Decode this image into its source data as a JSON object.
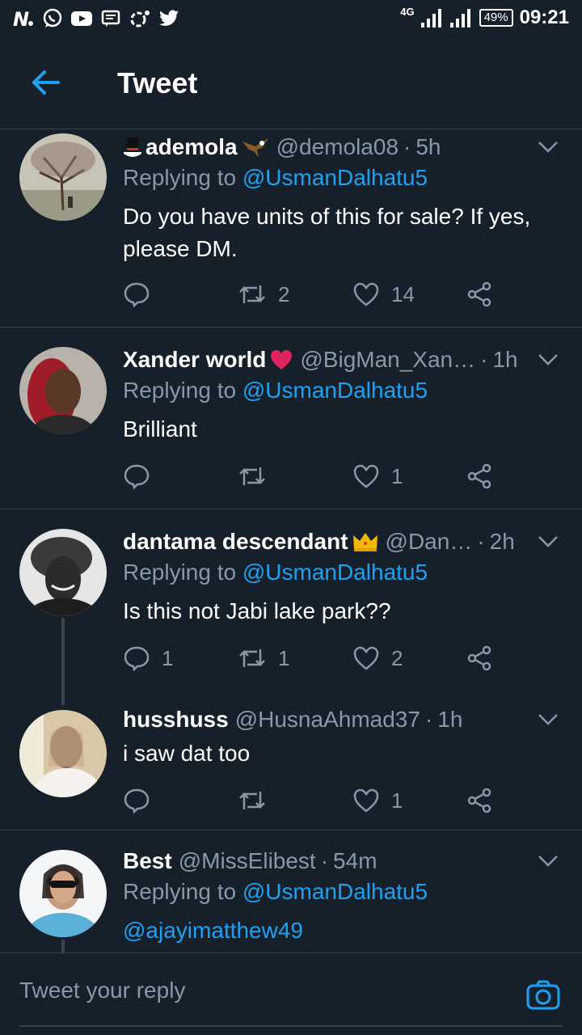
{
  "status_bar": {
    "network": "4G",
    "battery": "49%",
    "time": "09:21",
    "left_icons": [
      "news-icon",
      "whatsapp-icon",
      "youtube-icon",
      "message-icon",
      "ring-icon",
      "twitter-icon"
    ]
  },
  "header": {
    "title": "Tweet",
    "back_icon": "back-arrow-icon"
  },
  "tweets": [
    {
      "display_name": "ademola",
      "handle": "@demola08",
      "time": "5h",
      "reply_prefix": "Replying to ",
      "reply_to": "@UsmanDalhatu5",
      "text": "Do you have units of this for sale? If yes, please DM.",
      "replies": "",
      "retweets": "2",
      "likes": "14"
    },
    {
      "display_name": "Xander world",
      "handle": "@BigMan_Xan…",
      "time": "1h",
      "reply_prefix": "Replying to ",
      "reply_to": "@UsmanDalhatu5",
      "text": "Brilliant",
      "replies": "",
      "retweets": "",
      "likes": "1"
    },
    {
      "display_name": "dantama descendant",
      "handle": "@Dan…",
      "time": "2h",
      "reply_prefix": "Replying to ",
      "reply_to": "@UsmanDalhatu5",
      "text": "Is this not Jabi lake park??",
      "replies": "1",
      "retweets": "1",
      "likes": "2"
    },
    {
      "display_name": "husshuss",
      "handle": "@HusnaAhmad37",
      "time": "1h",
      "text": "i saw dat too",
      "replies": "",
      "retweets": "",
      "likes": "1"
    },
    {
      "display_name": "Best",
      "handle": "@MissElibest",
      "time": "54m",
      "reply_prefix": "Replying to ",
      "reply_to": "@UsmanDalhatu5",
      "text": "@ajayimatthew49"
    }
  ],
  "compose": {
    "placeholder": "Tweet your reply",
    "camera_icon": "camera-icon"
  },
  "colors": {
    "background": "#15202b",
    "divider": "#38444d",
    "secondary_text": "#8899a6",
    "accent": "#1da1f2"
  }
}
